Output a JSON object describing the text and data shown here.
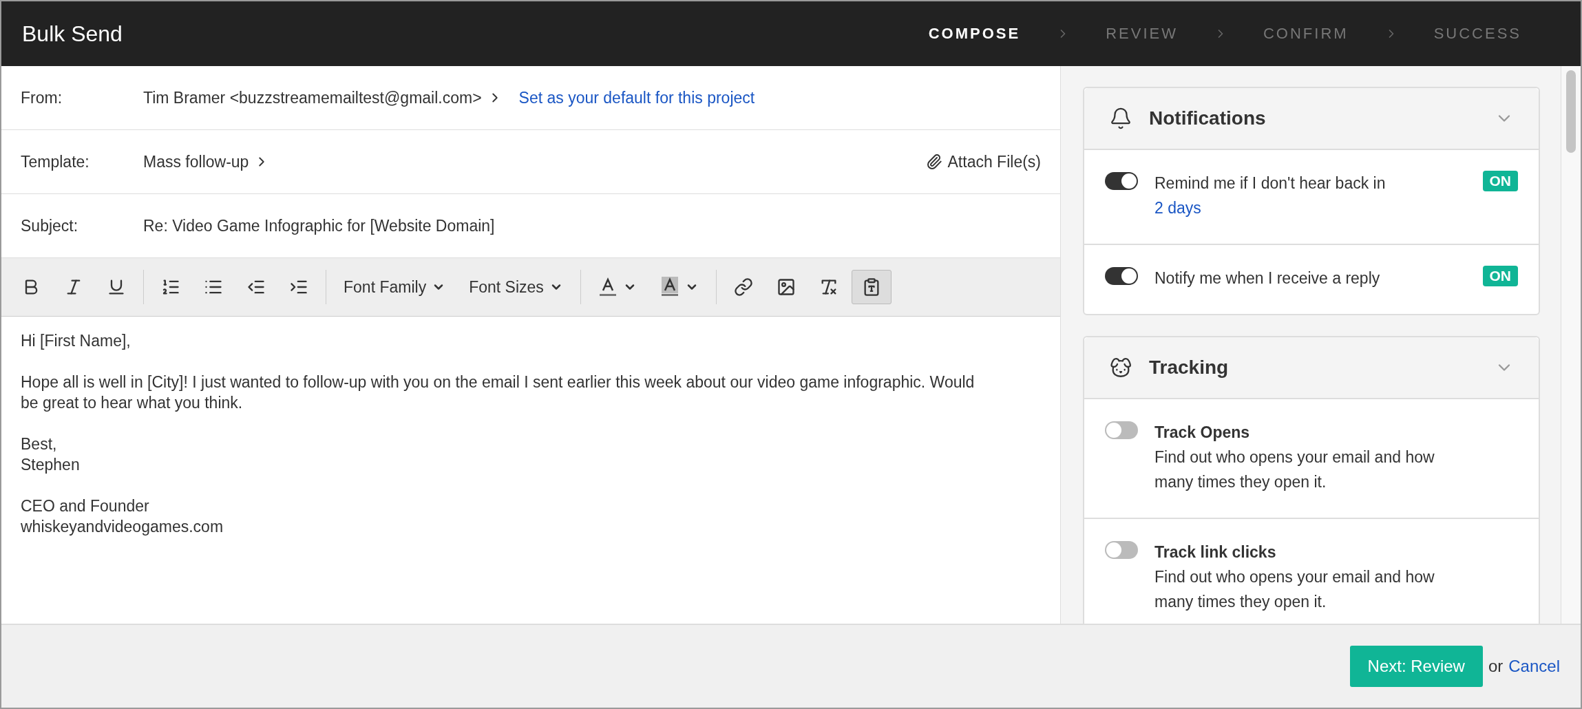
{
  "window": {
    "title": "Bulk Send"
  },
  "steps": [
    {
      "label": "COMPOSE",
      "selected": true
    },
    {
      "label": "REVIEW",
      "selected": false
    },
    {
      "label": "CONFIRM",
      "selected": false
    },
    {
      "label": "SUCCESS",
      "selected": false
    }
  ],
  "from": {
    "label": "From:",
    "value": "Tim Bramer <buzzstreamemailtest@gmail.com>",
    "link": "Set as your default for this project"
  },
  "template": {
    "label": "Template:",
    "value": "Mass follow-up",
    "attach": "Attach File(s)"
  },
  "subject": {
    "label": "Subject:",
    "value": "Re: Video Game Infographic for [Website Domain]"
  },
  "toolbar": {
    "dropdowns": [
      {
        "label": "Font Family"
      },
      {
        "label": "Font Sizes"
      }
    ],
    "paste_as_text": {
      "pressed": true
    }
  },
  "body": [
    [
      "Hi [First Name],"
    ],
    [
      "Hope all is well in [City]! I just wanted to follow-up with you on the email I sent earlier this week about our video game infographic. Would be great to hear what you think."
    ],
    [
      "Best,",
      "Stephen"
    ],
    [
      "CEO and Founder",
      "whiskeyandvideogames.com"
    ]
  ],
  "notifications": {
    "title": "Notifications",
    "items": [
      {
        "text": "Remind me if I don't hear back in",
        "link": "2 days",
        "on": true,
        "badge": "ON"
      },
      {
        "text": "Notify me when I receive a reply",
        "on": true,
        "badge": "ON"
      }
    ]
  },
  "tracking": {
    "title": "Tracking",
    "items": [
      {
        "title": "Track Opens",
        "description": "Find out who opens your email and how many times they open it.",
        "on": false
      },
      {
        "title": "Track link clicks",
        "description": "Find out who opens your email and how many times they open it.",
        "on": false
      }
    ]
  },
  "footer": {
    "primary": "Next: Review",
    "or": "or",
    "cancel": "Cancel"
  }
}
